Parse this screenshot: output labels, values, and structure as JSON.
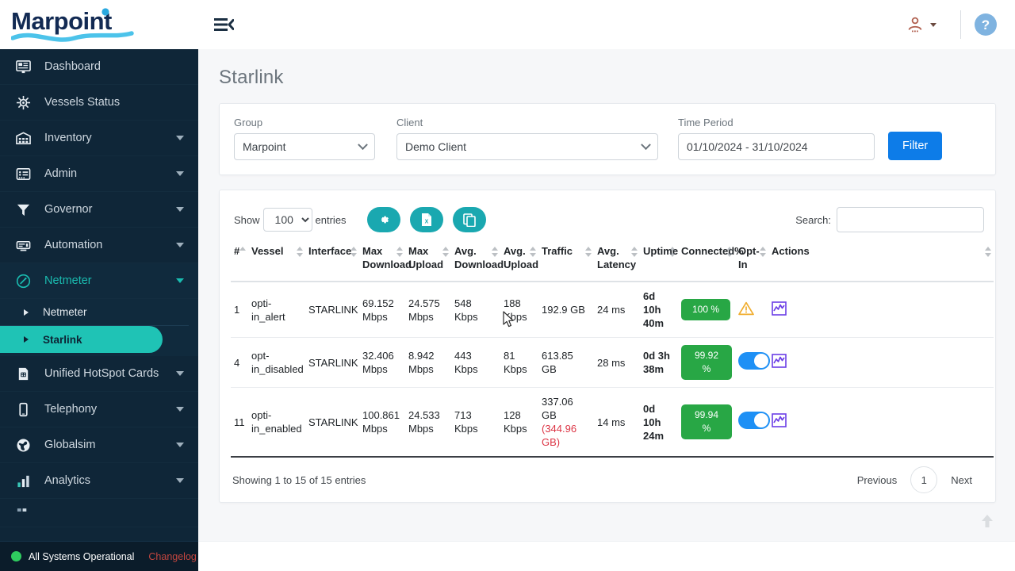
{
  "brand": {
    "name": "Marpoint"
  },
  "topbar": {
    "menu_toggle_icon": "menu-fold-icon",
    "user_icon": "user-icon",
    "help_icon": "help-circle-icon"
  },
  "sidebar": {
    "items": [
      {
        "label": "Dashboard",
        "icon": "dashboard-icon",
        "has_children": false
      },
      {
        "label": "Vessels Status",
        "icon": "ship-wheel-icon",
        "has_children": false
      },
      {
        "label": "Inventory",
        "icon": "warehouse-icon",
        "has_children": true
      },
      {
        "label": "Admin",
        "icon": "admin-list-icon",
        "has_children": true
      },
      {
        "label": "Governor",
        "icon": "funnel-icon",
        "has_children": true
      },
      {
        "label": "Automation",
        "icon": "automation-icon",
        "has_children": true
      },
      {
        "label": "Netmeter",
        "icon": "gauge-icon",
        "has_children": true,
        "active": true
      },
      {
        "label": "Unified HotSpot Cards",
        "icon": "sim-card-icon",
        "has_children": true
      },
      {
        "label": "Telephony",
        "icon": "mobile-icon",
        "has_children": true
      },
      {
        "label": "Globalsim",
        "icon": "globe-icon",
        "has_children": true
      },
      {
        "label": "Analytics",
        "icon": "bar-chart-icon",
        "has_children": true
      }
    ],
    "netmeter_submenu": [
      {
        "label": "Netmeter",
        "selected": false
      },
      {
        "label": "Starlink",
        "selected": true
      }
    ]
  },
  "status_bar": {
    "status_text": "All Systems Operational",
    "status_color": "#2fcc5f",
    "changelog_label": "Changelog",
    "changelog_color": "#c4463f"
  },
  "page": {
    "title": "Starlink"
  },
  "filters": {
    "group": {
      "label": "Group",
      "value": "Marpoint"
    },
    "client": {
      "label": "Client",
      "value": "Demo Client"
    },
    "time_period": {
      "label": "Time Period",
      "value": "01/10/2024 - 31/10/2024",
      "placeholder": ""
    },
    "filter_button": "Filter"
  },
  "table_controls": {
    "show_label": "Show",
    "entries_label": "entries",
    "page_length": "100",
    "search_label": "Search:",
    "search_value": "",
    "search_placeholder": "",
    "buttons": [
      {
        "name": "column-settings-button",
        "icon": "gear-icon"
      },
      {
        "name": "export-excel-button",
        "icon": "excel-file-icon"
      },
      {
        "name": "copy-button",
        "icon": "copy-icon"
      }
    ],
    "button_color": "#1aa8b0"
  },
  "table": {
    "columns": [
      "#",
      "Vessel",
      "Interface",
      "Max Download",
      "Max Upload",
      "Avg. Download",
      "Avg. Upload",
      "Traffic",
      "Avg. Latency",
      "Uptime",
      "Connected%",
      "Opt-In",
      "Actions"
    ],
    "rows": [
      {
        "num": "1",
        "vessel": "opti-in_alert",
        "interface": "STARLINK",
        "max_download": "69.152 Mbps",
        "max_upload": "24.575 Mbps",
        "avg_download": "548 Kbps",
        "avg_upload": "188 Kbps",
        "traffic": "192.9 GB",
        "traffic_alt": "",
        "avg_latency": "24 ms",
        "uptime_days": "6d",
        "uptime_hours": "10h",
        "uptime_minutes": "40m",
        "connected": "100 %",
        "optin_type": "warning",
        "action_icon": "chart-icon"
      },
      {
        "num": "4",
        "vessel": "opt-in_disabled",
        "interface": "STARLINK",
        "max_download": "32.406 Mbps",
        "max_upload": "8.942 Mbps",
        "avg_download": "443 Kbps",
        "avg_upload": "81 Kbps",
        "traffic": "613.85 GB",
        "traffic_alt": "",
        "avg_latency": "28 ms",
        "uptime_days": "0d",
        "uptime_hours": "3h",
        "uptime_minutes": "38m",
        "connected": "99.92 %",
        "optin_type": "toggle-on",
        "action_icon": "chart-icon"
      },
      {
        "num": "11",
        "vessel": "opti-in_enabled",
        "interface": "STARLINK",
        "max_download": "100.861 Mbps",
        "max_upload": "24.533 Mbps",
        "avg_download": "713 Kbps",
        "avg_upload": "128 Kbps",
        "traffic": "337.06 GB",
        "traffic_alt": "(344.96 GB)",
        "avg_latency": "14 ms",
        "uptime_days": "0d",
        "uptime_hours": "10h",
        "uptime_minutes": "24m",
        "connected": "99.94 %",
        "optin_type": "toggle-on",
        "action_icon": "chart-icon"
      }
    ],
    "badge_color": "#28a745",
    "toggle_color": "#1e90f5"
  },
  "pagination": {
    "info": "Showing 1 to 15 of 15 entries",
    "previous": "Previous",
    "current_page": "1",
    "next": "Next"
  }
}
